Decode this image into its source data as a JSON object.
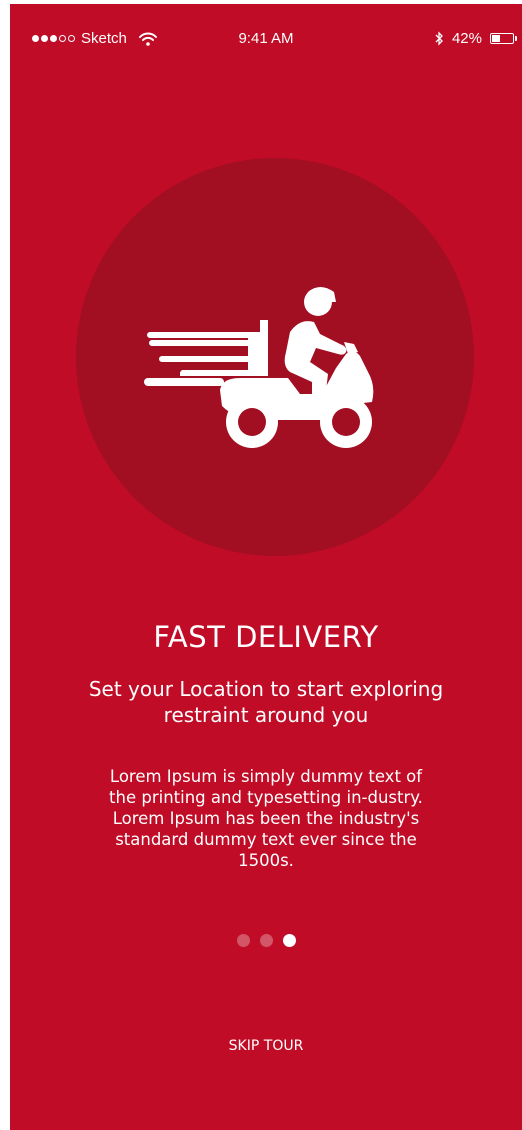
{
  "status_bar": {
    "carrier": "Sketch",
    "time": "9:41 AM",
    "battery": "42%",
    "battery_level": 0.42,
    "signal_bars_filled": 3,
    "signal_bars_total": 5
  },
  "hero": {
    "icon": "scooter-delivery-icon"
  },
  "content": {
    "title": "FAST DELIVERY",
    "subtitle": "Set your Location to start exploring restraint around you",
    "body": "Lorem Ipsum is simply dummy text of the printing and typesetting in-dustry. Lorem Ipsum has been the industry's standard dummy text ever since the 1500s."
  },
  "pager": {
    "total": 3,
    "active": 3
  },
  "actions": {
    "skip_label": "SKIP TOUR"
  },
  "colors": {
    "background": "#c10c27",
    "circle": "#a20e22",
    "foreground": "#ffffff"
  }
}
